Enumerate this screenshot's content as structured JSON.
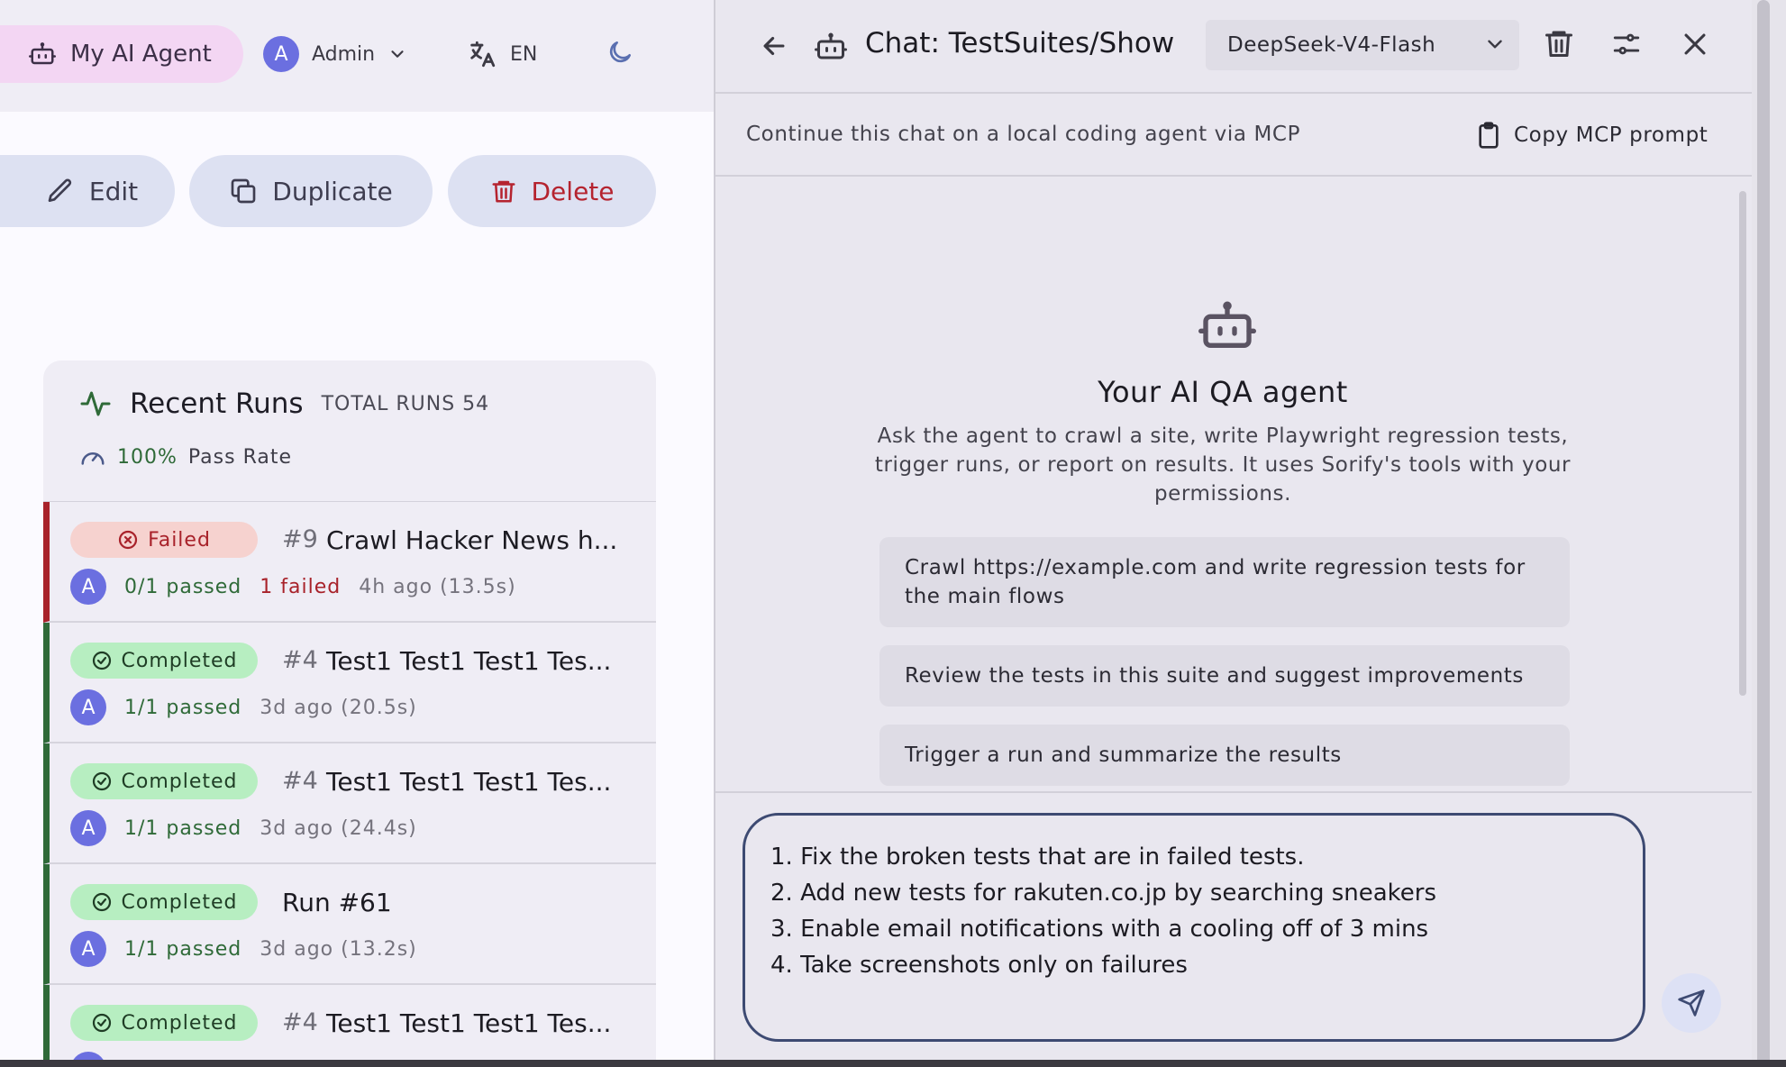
{
  "header": {
    "agent_label": "My AI Agent",
    "user_initial": "A",
    "user_name": "Admin",
    "language": "EN"
  },
  "actions": {
    "edit": "Edit",
    "duplicate": "Duplicate",
    "delete": "Delete"
  },
  "recent_runs": {
    "title": "Recent Runs",
    "total_label": "TOTAL RUNS 54",
    "pass_rate_value": "100%",
    "pass_rate_label": "Pass Rate",
    "runs": [
      {
        "status": "Failed",
        "number": "#9",
        "name": "Crawl Hacker News h...",
        "avatar": "A",
        "passed": "0/1 passed",
        "failed": "1 failed",
        "ago": "4h ago (13.5s)"
      },
      {
        "status": "Completed",
        "number": "#4",
        "name": "Test1 Test1 Test1 Tes...",
        "avatar": "A",
        "passed": "1/1 passed",
        "ago": "3d ago (20.5s)"
      },
      {
        "status": "Completed",
        "number": "#4",
        "name": "Test1 Test1 Test1 Tes...",
        "avatar": "A",
        "passed": "1/1 passed",
        "ago": "3d ago (24.4s)"
      },
      {
        "status": "Completed",
        "name": "Run #61",
        "avatar": "A",
        "passed": "1/1 passed",
        "ago": "3d ago (13.2s)"
      },
      {
        "status": "Completed",
        "number": "#4",
        "name": "Test1 Test1 Test1 Tes..."
      }
    ]
  },
  "chat": {
    "title": "Chat: TestSuites/Show",
    "model": "DeepSeek-V4-Flash",
    "mcp_text": "Continue this chat on a local coding agent via MCP",
    "mcp_copy": "Copy MCP prompt",
    "welcome_title": "Your AI QA agent",
    "welcome_desc": "Ask the agent to crawl a site, write Playwright regression tests, trigger runs, or report on results. It uses Sorify's tools with your permissions.",
    "suggestions": [
      "Crawl https://example.com and write regression tests for the main flows",
      "Review the tests in this suite and suggest improvements",
      "Trigger a run and summarize the results"
    ],
    "input_value": "1. Fix the broken tests that are in failed tests.\n2. Add new tests for rakuten.co.jp by searching sneakers\n3. Enable email notifications with a cooling off of 3 mins\n4. Take screenshots only on failures"
  },
  "colors": {
    "accent_pink": "#f3d6f3",
    "success": "#2f6a38",
    "danger": "#a8222a",
    "avatar": "#6b6fe0",
    "input_border": "#3d4a72"
  }
}
